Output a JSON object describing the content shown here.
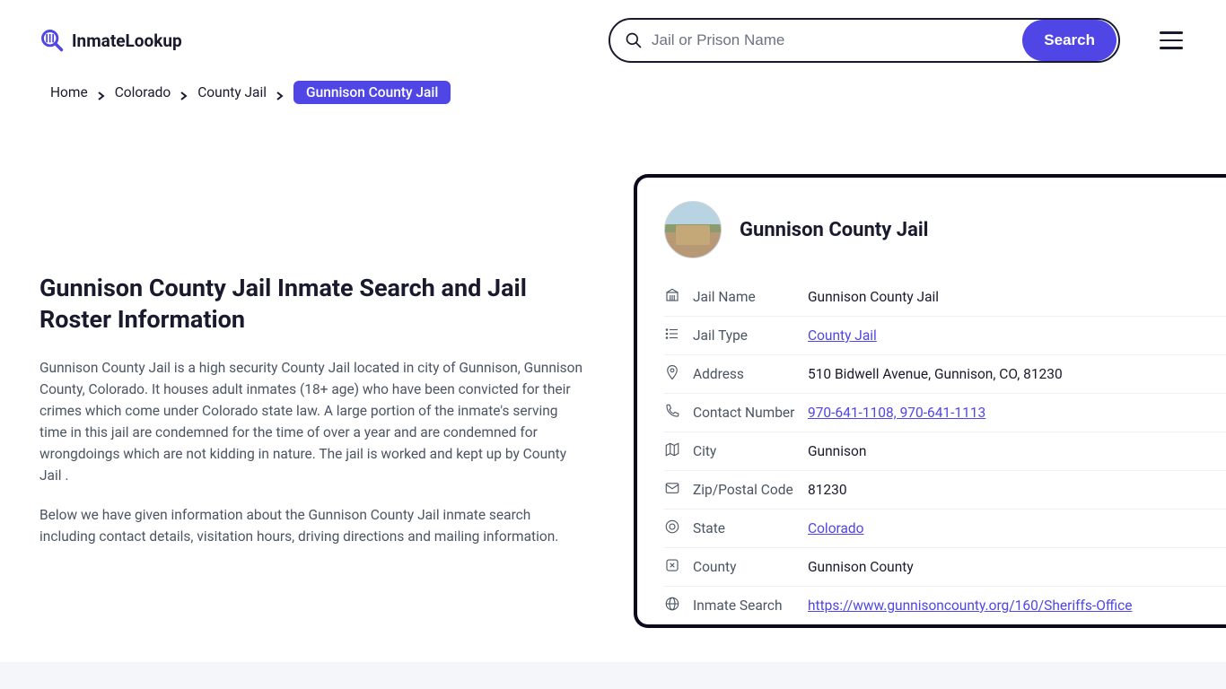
{
  "logo": {
    "text": "InmateLookup"
  },
  "search": {
    "placeholder": "Jail or Prison Name",
    "button": "Search"
  },
  "breadcrumb": {
    "items": [
      {
        "label": "Home"
      },
      {
        "label": "Colorado"
      },
      {
        "label": "County Jail"
      }
    ],
    "active": "Gunnison County Jail"
  },
  "page": {
    "title": "Gunnison County Jail Inmate Search and Jail Roster Information",
    "p1": "Gunnison County Jail is a high security County Jail located in city of Gunnison, Gunnison County, Colorado. It houses adult inmates (18+ age) who have been convicted for their crimes which come under Colorado state law. A large portion of the inmate's serving time in this jail are condemned for the time of over a year and are condemned for wrongdoings which are not kidding in nature. The jail is worked and kept up by County Jail .",
    "p2": "Below we have given information about the Gunnison County Jail inmate search including contact details, visitation hours, driving directions and mailing information."
  },
  "card": {
    "title": "Gunnison County Jail",
    "rows": [
      {
        "icon": "building",
        "label": "Jail Name",
        "value": "Gunnison County Jail",
        "link": false
      },
      {
        "icon": "list",
        "label": "Jail Type",
        "value": "County Jail",
        "link": true
      },
      {
        "icon": "pin",
        "label": "Address",
        "value": "510 Bidwell Avenue, Gunnison, CO, 81230",
        "link": false
      },
      {
        "icon": "phone",
        "label": "Contact Number",
        "value": "970-641-1108, 970-641-1113",
        "link": true
      },
      {
        "icon": "map",
        "label": "City",
        "value": "Gunnison",
        "link": false
      },
      {
        "icon": "mail",
        "label": "Zip/Postal Code",
        "value": "81230",
        "link": false
      },
      {
        "icon": "circle",
        "label": "State",
        "value": "Colorado",
        "link": true
      },
      {
        "icon": "square",
        "label": "County",
        "value": "Gunnison County",
        "link": false
      },
      {
        "icon": "globe",
        "label": "Inmate Search",
        "value": "https://www.gunnisoncounty.org/160/Sheriffs-Office",
        "link": true
      }
    ]
  }
}
